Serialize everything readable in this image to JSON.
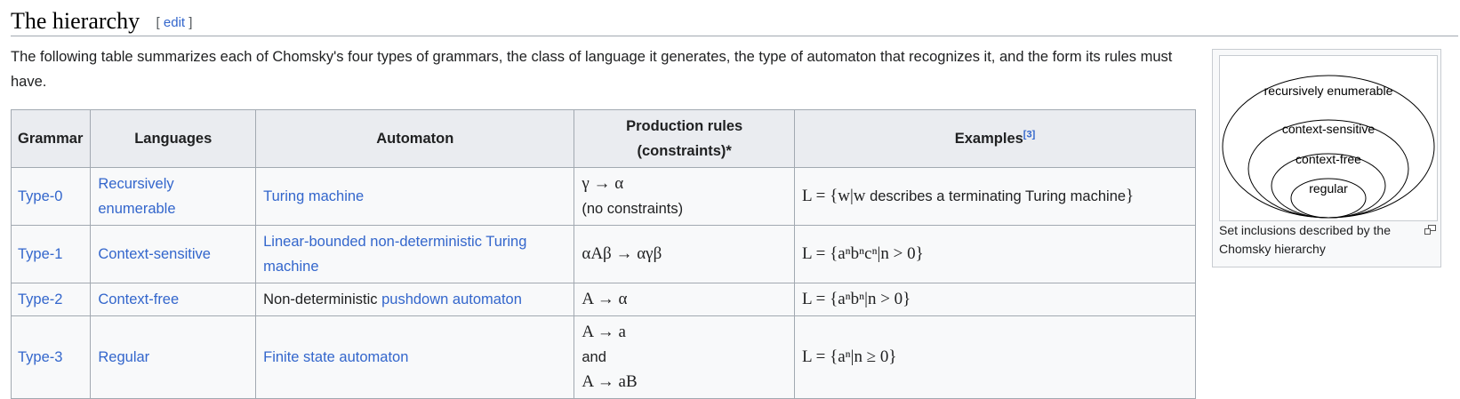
{
  "heading": {
    "title": "The hierarchy",
    "edit_open": "[",
    "edit_label": "edit",
    "edit_close": "]"
  },
  "intro": "The following table summarizes each of Chomsky's four types of grammars, the class of language it generates, the type of automaton that recognizes it, and the form its rules must have.",
  "table": {
    "headers": {
      "grammar": "Grammar",
      "languages": "Languages",
      "automaton": "Automaton",
      "rules": "Production rules (constraints)*",
      "examples": "Examples",
      "examples_ref": "[3]"
    },
    "rows": [
      {
        "grammar": "Type-0",
        "language": "Recursively enumerable",
        "automaton_prefix": "",
        "automaton": "Turing machine",
        "rule1": "γ → α",
        "rule_note": "(no constraints)",
        "example_pre": "L = {w|w",
        "example_text": " describes a terminating Turing machine",
        "example_post": "}"
      },
      {
        "grammar": "Type-1",
        "language": "Context-sensitive",
        "automaton_prefix": "",
        "automaton": "Linear-bounded non-deterministic Turing machine",
        "rule1": "αAβ → αγβ",
        "example": "L = {aⁿbⁿcⁿ|n > 0}"
      },
      {
        "grammar": "Type-2",
        "language": "Context-free",
        "automaton_prefix": "Non-deterministic ",
        "automaton": "pushdown automaton",
        "rule1": "A → α",
        "example": "L = {aⁿbⁿ|n > 0}"
      },
      {
        "grammar": "Type-3",
        "language": "Regular",
        "automaton_prefix": "",
        "automaton": "Finite state automaton",
        "rule1": "A → a",
        "rule_joiner": "and",
        "rule2": "A → aB",
        "example": "L = {aⁿ|n ≥ 0}"
      }
    ]
  },
  "figure": {
    "labels": {
      "outer": "recursively enumerable",
      "second": "context-sensitive",
      "third": "context-free",
      "inner": "regular"
    },
    "caption": "Set inclusions described by the Chomsky hierarchy",
    "magnify_icon": "magnify-clip-icon"
  }
}
